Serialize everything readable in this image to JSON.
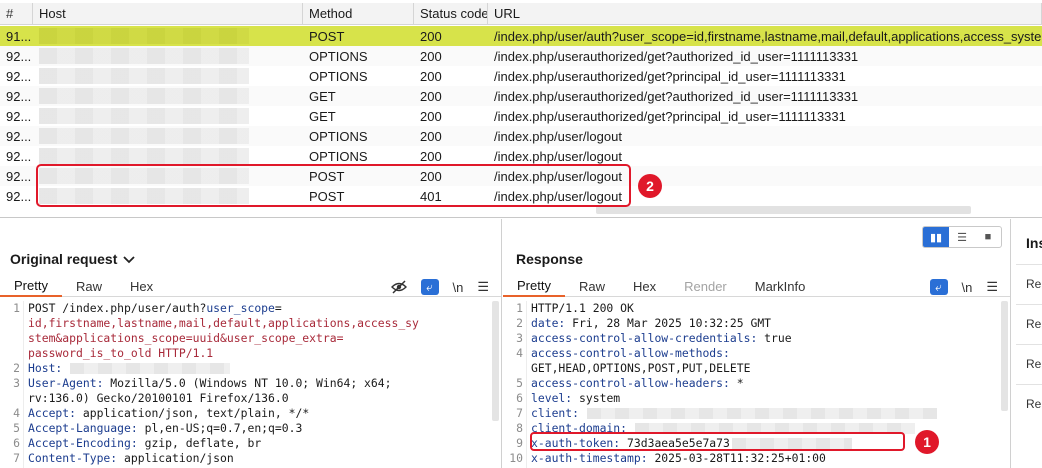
{
  "history": {
    "columns": [
      "#",
      "Host",
      "Method",
      "Status code",
      "URL"
    ],
    "rows": [
      {
        "num": "91...",
        "method": "POST",
        "status": "200",
        "url": "/index.php/user/auth?user_scope=id,firstname,lastname,mail,default,applications,access_syste..."
      },
      {
        "num": "92...",
        "method": "OPTIONS",
        "status": "200",
        "url": "/index.php/userauthorized/get?authorized_id_user=1111113331"
      },
      {
        "num": "92...",
        "method": "OPTIONS",
        "status": "200",
        "url": "/index.php/userauthorized/get?principal_id_user=1111113331"
      },
      {
        "num": "92...",
        "method": "GET",
        "status": "200",
        "url": "/index.php/userauthorized/get?authorized_id_user=1111113331"
      },
      {
        "num": "92...",
        "method": "GET",
        "status": "200",
        "url": "/index.php/userauthorized/get?principal_id_user=1111113331"
      },
      {
        "num": "92...",
        "method": "OPTIONS",
        "status": "200",
        "url": "/index.php/user/logout"
      },
      {
        "num": "92...",
        "method": "OPTIONS",
        "status": "200",
        "url": "/index.php/user/logout"
      },
      {
        "num": "92...",
        "method": "POST",
        "status": "200",
        "url": "/index.php/user/logout"
      },
      {
        "num": "92...",
        "method": "POST",
        "status": "401",
        "url": "/index.php/user/logout"
      }
    ],
    "marker": "2"
  },
  "request": {
    "title": "Original request",
    "tabs": [
      "Pretty",
      "Raw",
      "Hex"
    ],
    "wrap_label": "\\n",
    "lines": [
      {
        "n": "1",
        "a": "POST /index.php/user/auth?",
        "b": "user_scope",
        "c": "="
      },
      {
        "n": "",
        "a": "",
        "b": "",
        "c": "id,firstname,lastname,mail,default,applications,access_sy"
      },
      {
        "n": "",
        "a": "",
        "b": "",
        "c": "stem&applications_scope=uuid&user_scope_extra="
      },
      {
        "n": "",
        "a": "",
        "b": "",
        "c": "password_is_to_old HTTP/1.1"
      },
      {
        "n": "2",
        "a": "Host:",
        "b": "",
        "c": ""
      },
      {
        "n": "3",
        "a": "User-Agent:",
        "b": " Mozilla/5.0 (Windows NT 10.0; Win64; x64;",
        "c": ""
      },
      {
        "n": "",
        "a": "",
        "b": "rv:136.0) Gecko/20100101 Firefox/136.0",
        "c": ""
      },
      {
        "n": "4",
        "a": "Accept:",
        "b": " application/json, text/plain, */*",
        "c": ""
      },
      {
        "n": "5",
        "a": "Accept-Language:",
        "b": " pl,en-US;q=0.7,en;q=0.3",
        "c": ""
      },
      {
        "n": "6",
        "a": "Accept-Encoding:",
        "b": " gzip, deflate, br",
        "c": ""
      },
      {
        "n": "7",
        "a": "Content-Type:",
        "b": " application/json",
        "c": ""
      }
    ]
  },
  "response": {
    "title": "Response",
    "tabs": [
      "Pretty",
      "Raw",
      "Hex",
      "Render",
      "MarkInfo"
    ],
    "wrap_label": "\\n",
    "lines": [
      {
        "n": "1",
        "a": "HTTP/1.1 200 OK",
        "b": ""
      },
      {
        "n": "2",
        "a": "date:",
        "b": " Fri, 28 Mar 2025 10:32:25 GMT"
      },
      {
        "n": "3",
        "a": "access-control-allow-credentials:",
        "b": " true"
      },
      {
        "n": "4",
        "a": "access-control-allow-methods:",
        "b": ""
      },
      {
        "n": "",
        "a": "",
        "b": "GET,HEAD,OPTIONS,POST,PUT,DELETE"
      },
      {
        "n": "5",
        "a": "access-control-allow-headers:",
        "b": " *"
      },
      {
        "n": "6",
        "a": "level:",
        "b": " system"
      },
      {
        "n": "7",
        "a": "client:",
        "b": ""
      },
      {
        "n": "8",
        "a": "client-domain:",
        "b": ""
      },
      {
        "n": "9",
        "a": "x-auth-token:",
        "b": " 73d3aea5e5e7a73"
      },
      {
        "n": "10",
        "a": "x-auth-timestamp:",
        "b": " 2025-03-28T11:32:25+01:00"
      }
    ],
    "marker": "1"
  },
  "inspector": {
    "title": "Ins",
    "rows": [
      "Re",
      "Re",
      "Re",
      "Re"
    ]
  }
}
